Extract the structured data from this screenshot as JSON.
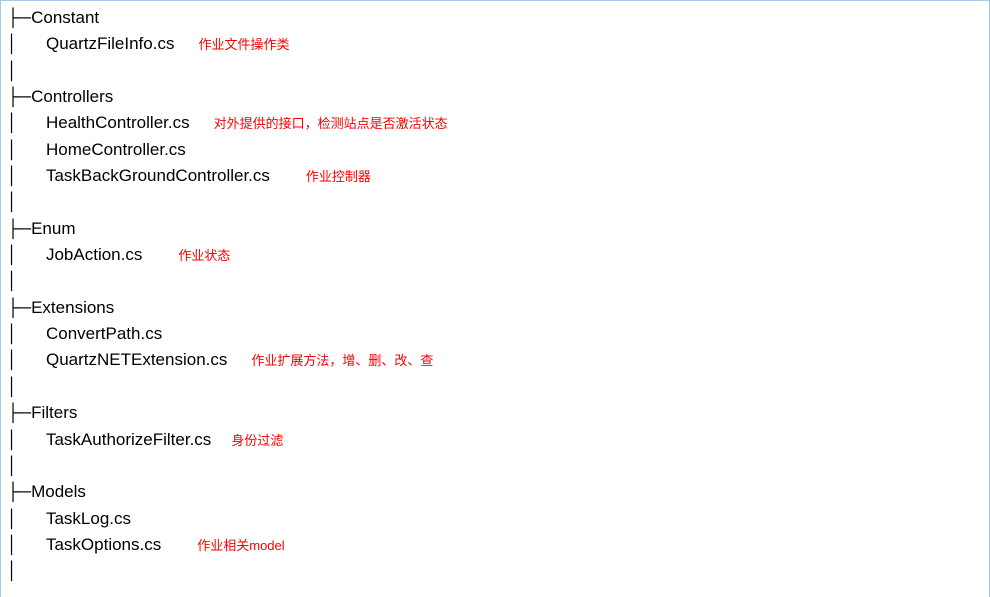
{
  "folders": [
    {
      "name": "Constant",
      "files": [
        {
          "name": "QuartzFileInfo.cs",
          "annotation": "作业文件操作类",
          "annClass": "annotation"
        }
      ]
    },
    {
      "name": "Controllers",
      "files": [
        {
          "name": "HealthController.cs",
          "annotation": "对外提供的接口，检测站点是否激活状态",
          "annClass": "annotation"
        },
        {
          "name": "HomeController.cs",
          "annotation": "",
          "annClass": ""
        },
        {
          "name": "TaskBackGroundController.cs",
          "annotation": "作业控制器",
          "annClass": "annotation wide"
        }
      ]
    },
    {
      "name": "Enum",
      "files": [
        {
          "name": "JobAction.cs",
          "annotation": "作业状态",
          "annClass": "annotation wide"
        }
      ]
    },
    {
      "name": "Extensions",
      "files": [
        {
          "name": "ConvertPath.cs",
          "annotation": "",
          "annClass": ""
        },
        {
          "name": "QuartzNETExtension.cs",
          "annotation": "作业扩展方法，增、删、改、查",
          "annClass": "annotation"
        }
      ]
    },
    {
      "name": "Filters",
      "files": [
        {
          "name": "TaskAuthorizeFilter.cs",
          "annotation": "身份过滤",
          "annClass": "annotation narrow"
        }
      ]
    },
    {
      "name": "Models",
      "files": [
        {
          "name": "TaskLog.cs",
          "annotation": "",
          "annClass": ""
        },
        {
          "name": "TaskOptions.cs",
          "annotation": "作业相关model",
          "annClass": "annotation wide"
        }
      ]
    }
  ],
  "prefixes": {
    "folder": "├─",
    "file": "│      ",
    "blank": "│"
  }
}
